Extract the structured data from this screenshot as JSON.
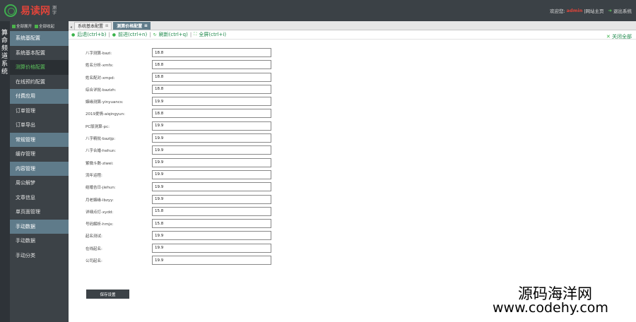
{
  "header": {
    "logo_name": "易读网",
    "logo_sub": "测字",
    "welcome": "欢迎您:",
    "username": "admin",
    "site_home": "|网站主页",
    "logout": "退出系统"
  },
  "vertical_title": "算命频道系统",
  "sidebar": {
    "expand_all": "全部展开",
    "collapse_all": "全部收起",
    "items": [
      {
        "label": "系统基配置",
        "kind": "head"
      },
      {
        "label": "系统基本配置",
        "kind": "item"
      },
      {
        "label": "测算价格配置",
        "kind": "active"
      },
      {
        "label": "在线预约配置",
        "kind": "item"
      },
      {
        "label": "付费应用",
        "kind": "head"
      },
      {
        "label": "订单管理",
        "kind": "item"
      },
      {
        "label": "订单导出",
        "kind": "item"
      },
      {
        "label": "常规管理",
        "kind": "head"
      },
      {
        "label": "缓存管理",
        "kind": "item"
      },
      {
        "label": "内容管理",
        "kind": "head"
      },
      {
        "label": "周公解梦",
        "kind": "item"
      },
      {
        "label": "文章信息",
        "kind": "item"
      },
      {
        "label": "单页面管理",
        "kind": "item"
      },
      {
        "label": "手动数据",
        "kind": "head"
      },
      {
        "label": "手动数据",
        "kind": "item"
      },
      {
        "label": "手动分类",
        "kind": "item"
      }
    ]
  },
  "tabs": [
    {
      "label": "系统基本配置",
      "active": false
    },
    {
      "label": "测算价格配置",
      "active": true
    }
  ],
  "toolbar": {
    "back": "后退(ctrl+b)",
    "forward": "前进(ctrl+n)",
    "refresh": "刷新(ctrl+q)",
    "fullscreen": "全屏(ctrl+i)",
    "close_all": "关闭全部"
  },
  "form": {
    "fields": [
      {
        "label": "八字测算-bazi:",
        "value": "18.8"
      },
      {
        "label": "姓名分析-xmfx:",
        "value": "18.8"
      },
      {
        "label": "姓名配对-xmpd:",
        "value": "18.8"
      },
      {
        "label": "综合详批-bazizh:",
        "value": "18.8"
      },
      {
        "label": "姻缘测算-yinyuancs:",
        "value": "19.9"
      },
      {
        "label": "2019爱情-aiqingyun:",
        "value": "18.8"
      },
      {
        "label": "PC版测算-pc:",
        "value": "19.9"
      },
      {
        "label": "八字精批-bazijp:",
        "value": "19.9"
      },
      {
        "label": "八字合婚-hehun:",
        "value": "19.9"
      },
      {
        "label": "紫微斗数-ziwei:",
        "value": "19.9"
      },
      {
        "label": "流年运程:",
        "value": "19.9"
      },
      {
        "label": "结婚吉日-jiehun:",
        "value": "19.9"
      },
      {
        "label": "月老姻缘-lbzyy:",
        "value": "19.9"
      },
      {
        "label": "详细点灯-xydd:",
        "value": "15.8"
      },
      {
        "label": "号码解析-hmjx:",
        "value": "15.8"
      },
      {
        "label": "起名测试:",
        "value": "19.9"
      },
      {
        "label": "在线起名:",
        "value": "19.9"
      },
      {
        "label": "公司起名:",
        "value": "19.9"
      }
    ],
    "save_label": "保存设置"
  },
  "watermark": {
    "line1": "源码海洋网",
    "line2": "www.codehy.com"
  }
}
